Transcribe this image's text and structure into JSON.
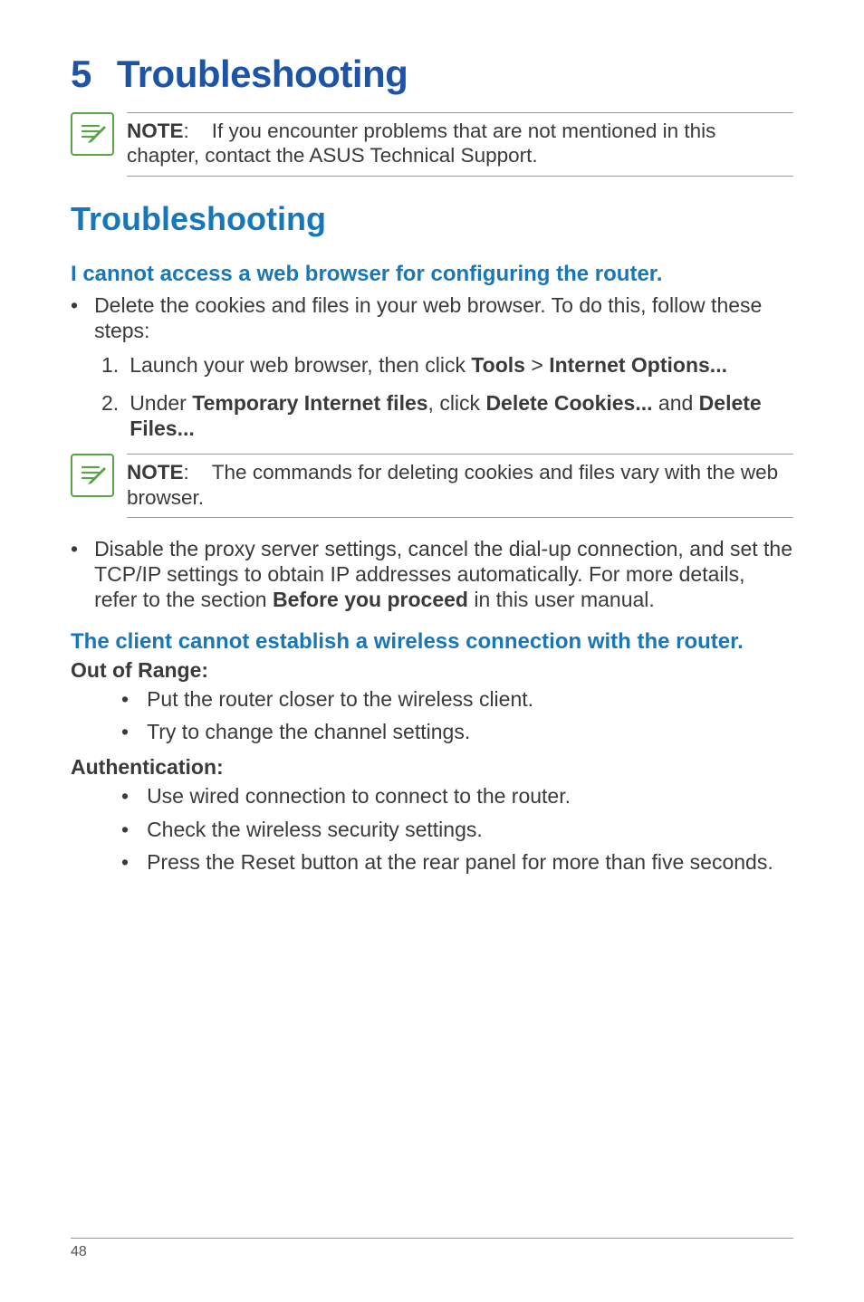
{
  "chapter": {
    "number": "5",
    "title": "Troubleshooting"
  },
  "note1": {
    "label": "NOTE",
    "sep": ":",
    "body": "If you encounter problems that are not mentioned in this chapter, contact the ASUS Technical Support."
  },
  "section_title": "Troubleshooting",
  "sub1_heading": "I cannot access a web browser for configuring the router.",
  "sub1_bullet1": "Delete the cookies and files in your web browser. To do this, follow these steps:",
  "sub1_step1": {
    "num": "1.",
    "pre": "Launch your web browser, then click ",
    "b1": "Tools",
    "gt": " > ",
    "b2": "Internet Options..."
  },
  "sub1_step2": {
    "num": "2.",
    "pre": "Under ",
    "b1": "Temporary Internet files",
    "mid": ", click ",
    "b2": "Delete Cookies...",
    "and": " and ",
    "b3": "Delete Files..."
  },
  "note2": {
    "label": "NOTE",
    "sep": ":",
    "body": "The commands for deleting cookies and files vary with the web browser."
  },
  "sub1_bullet2": {
    "pre": "Disable the proxy server settings, cancel the dial-up connection, and set the TCP/IP settings to obtain IP addresses automatically. For more details, refer to the section ",
    "b": "Before you proceed",
    "post": " in this user manual."
  },
  "sub2_heading": "The client cannot establish a wireless connection with the router.",
  "oor_label": "Out of Range:",
  "oor_items": [
    "Put the router closer to the wireless client.",
    "Try to change the channel settings."
  ],
  "auth_label": "Authentication:",
  "auth_items": [
    "Use wired connection to connect to the router.",
    "Check the wireless security settings.",
    "Press the Reset button at the rear panel for more than five seconds."
  ],
  "page_number": "48"
}
